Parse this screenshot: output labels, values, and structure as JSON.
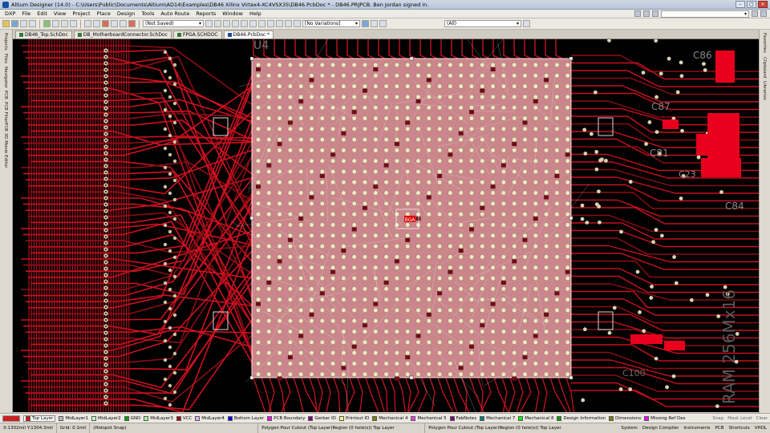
{
  "window": {
    "title": "Altium Designer (14.0) - C:\\Users\\Public\\Documents\\Altium\\AD14\\Examples\\DB46 Xilinx Virtex4-XC4VSX35\\DB46.PcbDoc * - DB46.PRJPCB. Ben Jordan signed in."
  },
  "menu": {
    "items": [
      "DXP",
      "File",
      "Edit",
      "View",
      "Project",
      "Place",
      "Design",
      "Tools",
      "Auto Route",
      "Reports",
      "Window",
      "Help"
    ]
  },
  "toolbar": {
    "variant_select": "(Not Saved)",
    "variations_select": "[No Variations]",
    "filter_select": "(All)"
  },
  "tabs": [
    {
      "label": "DB46_Top.SchDoc",
      "active": false
    },
    {
      "label": "DB_MotherboardConnector.SchDoc",
      "active": false
    },
    {
      "label": "FPGA.SCHDOC",
      "active": false
    },
    {
      "label": "DB46.PcbDoc *",
      "active": true
    }
  ],
  "left_panels": [
    "Projects",
    "Files",
    "Navigator",
    "PCB",
    "PCB Filter",
    "PCB 3D Movie Editor"
  ],
  "right_panels": [
    "Favorites",
    "Clipboard",
    "Libraries"
  ],
  "pcb": {
    "component_label": "BGA",
    "designators": [
      "U4",
      "C86",
      "C87",
      "C81",
      "C23",
      "C84",
      "C100"
    ],
    "right_text": "RAM 256Mx16"
  },
  "layers": [
    {
      "name": "Top Layer",
      "color": "#ff0000",
      "active": true
    },
    {
      "name": "MidLayer1",
      "color": "#bcbcbc"
    },
    {
      "name": "MidLayer2",
      "color": "#c0ffc0"
    },
    {
      "name": "GND",
      "color": "#00a000"
    },
    {
      "name": "MidLayer3",
      "color": "#a0ffa0"
    },
    {
      "name": "VCC",
      "color": "#a00000"
    },
    {
      "name": "MidLayer4",
      "color": "#e0b0ff"
    },
    {
      "name": "Bottom Layer",
      "color": "#0000ff"
    },
    {
      "name": "PCB Boundary",
      "color": "#ff00ff"
    },
    {
      "name": "Gerber ID",
      "color": "#800080"
    },
    {
      "name": "Printout ID",
      "color": "#ffff80"
    },
    {
      "name": "Mechanical 4",
      "color": "#808000"
    },
    {
      "name": "Mechanical 5",
      "color": "#ff40ff"
    },
    {
      "name": "FabNotes",
      "color": "#800080"
    },
    {
      "name": "Mechanical 7",
      "color": "#008080"
    },
    {
      "name": "Mechanical 8",
      "color": "#00ff00"
    },
    {
      "name": "Design Information",
      "color": "#00a000"
    },
    {
      "name": "Dimensions",
      "color": "#808000"
    },
    {
      "name": "Missing Ref Des",
      "color": "#ff00ff"
    }
  ],
  "layerbar_right": [
    "Snap",
    "Mask Level",
    "Clear"
  ],
  "status": {
    "coords": "X:1302mil Y:1304.3mil",
    "grid": "Grid: 0.1mil",
    "snap": "(Hotspot Snap)",
    "message_center": "Polygon Pour Cutout (Top Layer)Region (0 hole(s)) Top Layer",
    "message_right": "Polygon Pour Cutout (Top Layer)Region (0 hole(s)) Top Layer",
    "panels": [
      "System",
      "Design Compiler",
      "Instruments",
      "PCB",
      "Shortcuts",
      "VHDL"
    ]
  }
}
